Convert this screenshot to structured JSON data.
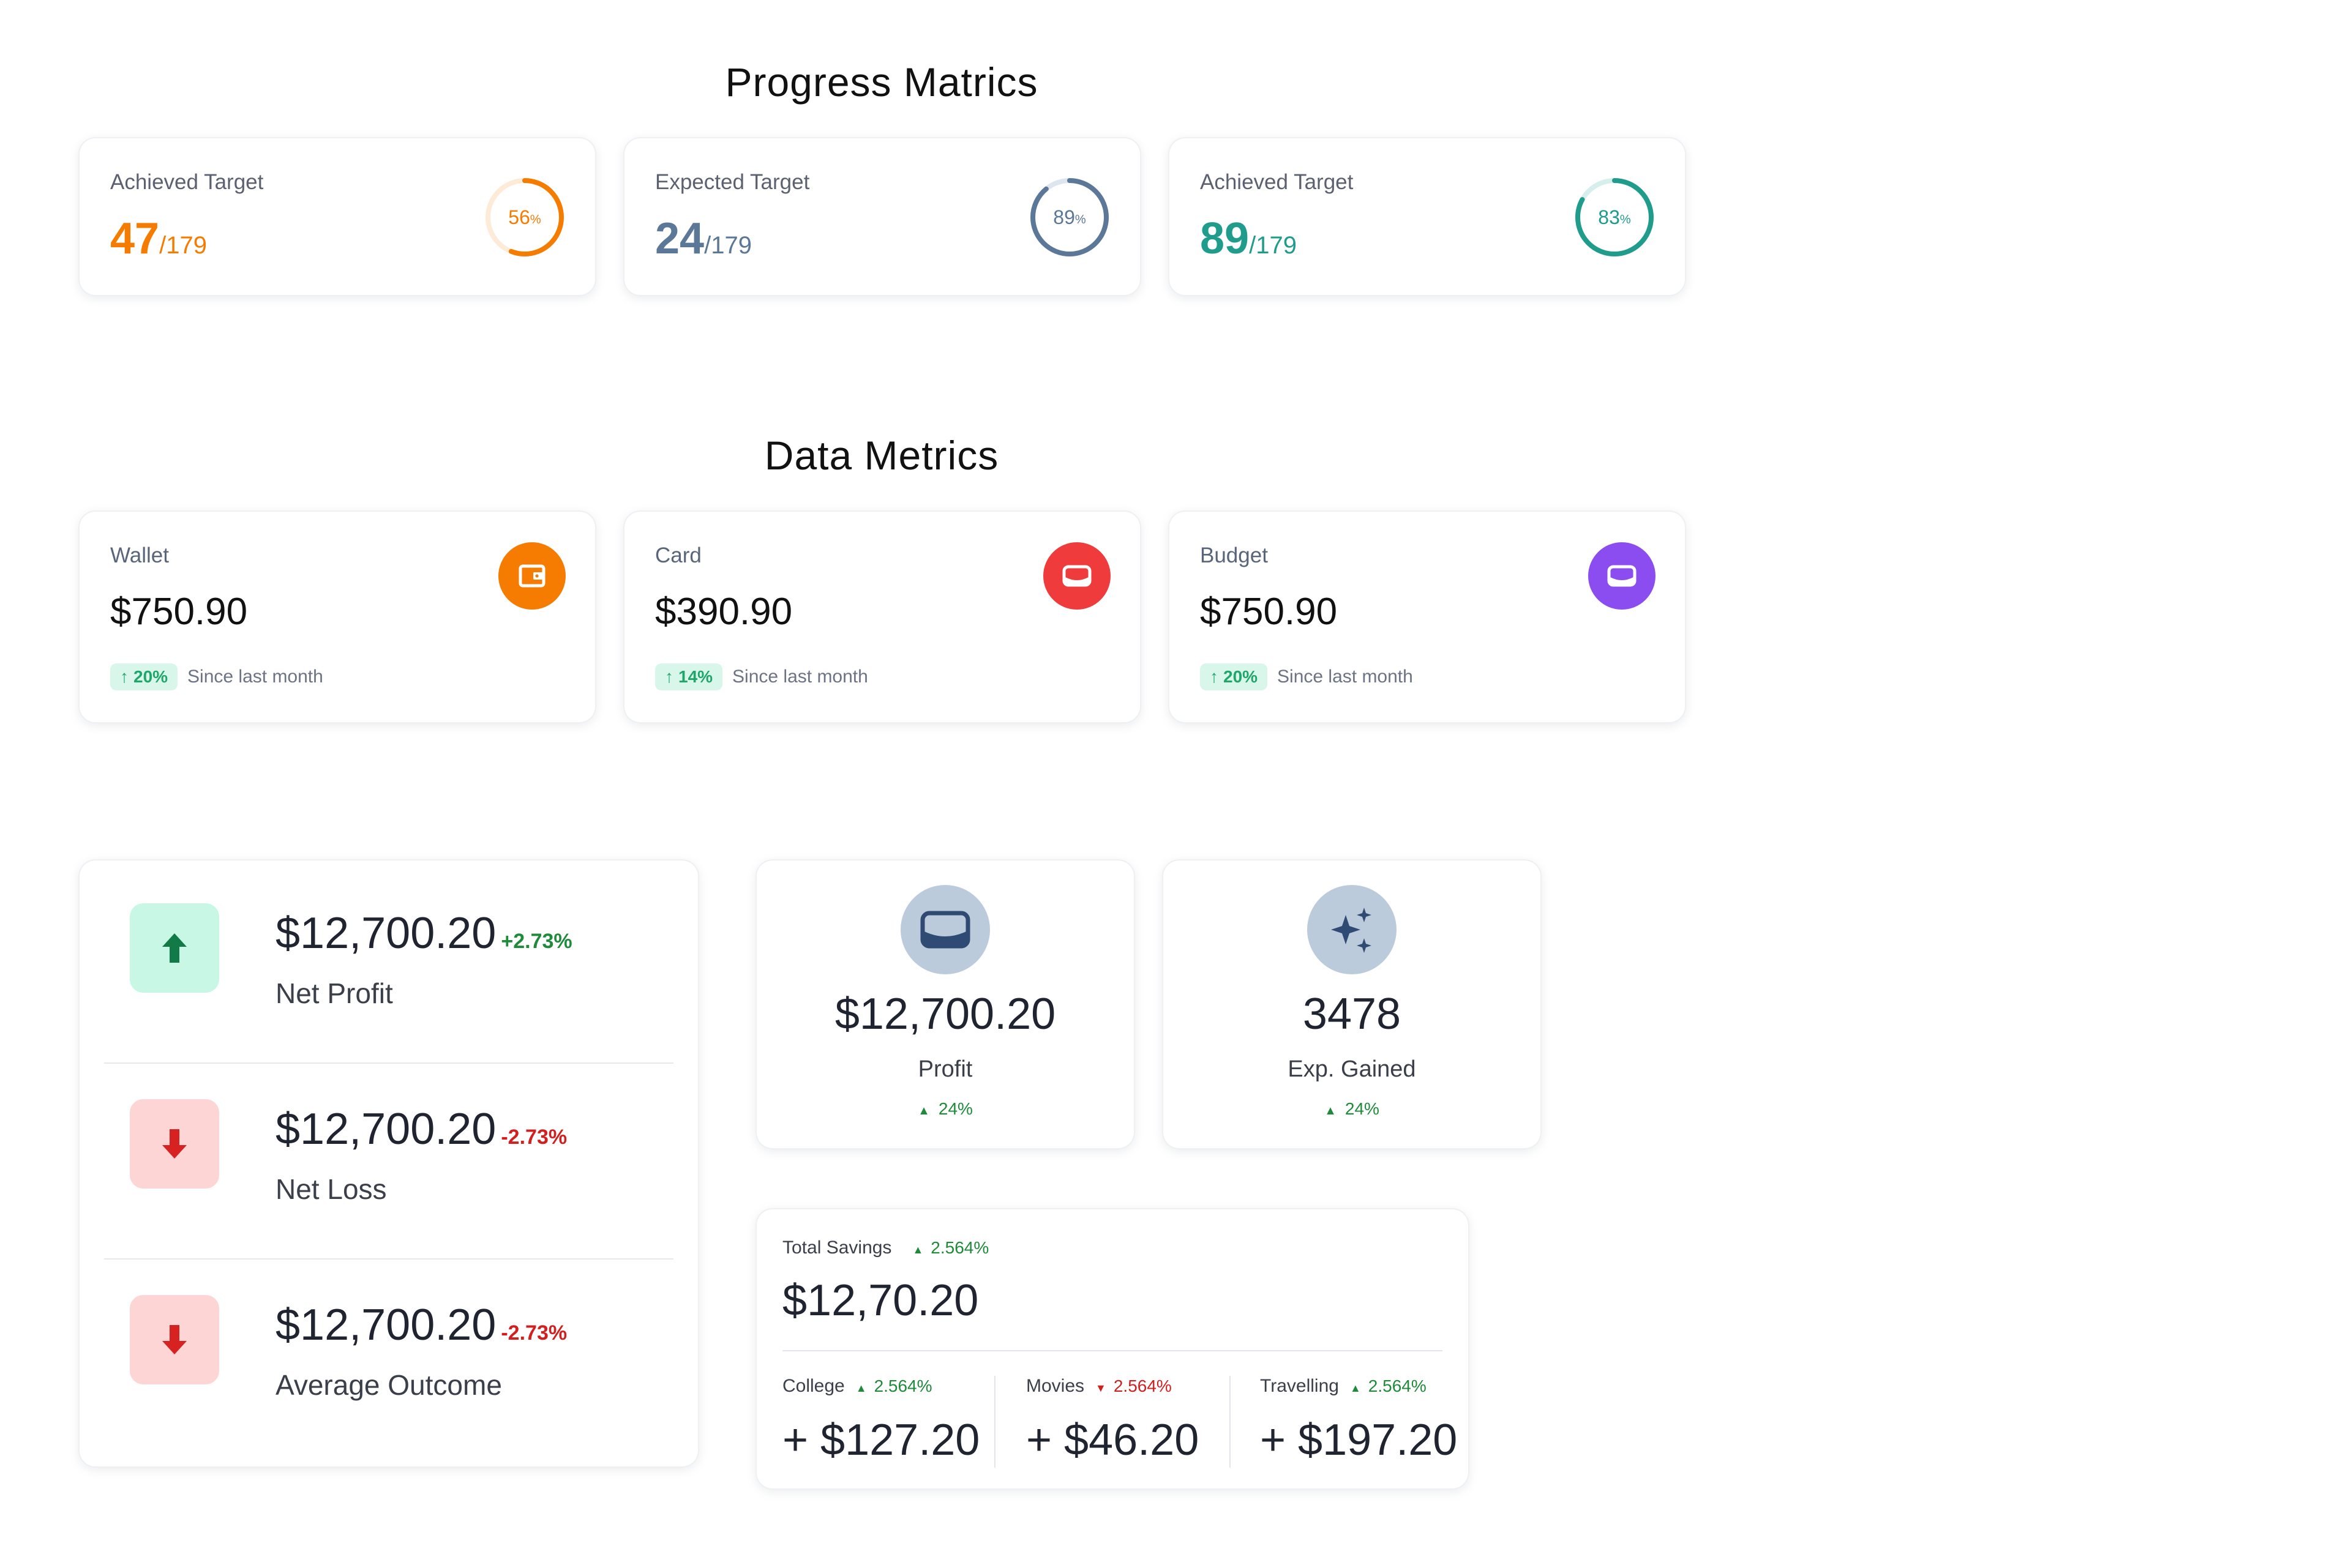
{
  "progress_section": {
    "title": "Progress Matrics",
    "cards": [
      {
        "label": "Achieved Target",
        "value": "47",
        "denominator": "/179",
        "percent": 56,
        "percent_label": "56",
        "percent_symbol": "%",
        "color": "#f57c00",
        "track_color": "#fdebd8"
      },
      {
        "label": "Expected Target",
        "value": "24",
        "denominator": "/179",
        "percent": 89,
        "percent_label": "89",
        "percent_symbol": "%",
        "color": "#5b7898",
        "track_color": "#dde5ee"
      },
      {
        "label": "Achieved Target",
        "value": "89",
        "denominator": "/179",
        "percent": 83,
        "percent_label": "83",
        "percent_symbol": "%",
        "color": "#1f9c8c",
        "track_color": "#d6efec"
      }
    ]
  },
  "data_section": {
    "title": "Data Metrics",
    "cards": [
      {
        "label": "Wallet",
        "value": "$750.90",
        "change": "20%",
        "since": "Since last month",
        "icon": "wallet-icon",
        "icon_color": "#f57c00"
      },
      {
        "label": "Card",
        "value": "$390.90",
        "change": "14%",
        "since": "Since last month",
        "icon": "card-icon",
        "icon_color": "#ef3b3b"
      },
      {
        "label": "Budget",
        "value": "$750.90",
        "change": "20%",
        "since": "Since last month",
        "icon": "card-icon",
        "icon_color": "#8b4cf0"
      }
    ]
  },
  "summary_list": {
    "items": [
      {
        "amount": "$12,700.20",
        "change": "+2.73%",
        "label": "Net Profit",
        "direction": "up",
        "icon": "arrow-up-icon"
      },
      {
        "amount": "$12,700.20",
        "change": "-2.73%",
        "label": "Net Loss",
        "direction": "down",
        "icon": "arrow-down-icon"
      },
      {
        "amount": "$12,700.20",
        "change": "-2.73%",
        "label": "Average Outcome",
        "direction": "down",
        "icon": "arrow-down-icon"
      }
    ]
  },
  "stat_cards": [
    {
      "value": "$12,700.20",
      "label": "Profit",
      "change": "24%",
      "icon": "card-icon"
    },
    {
      "value": "3478",
      "label": "Exp. Gained",
      "change": "24%",
      "icon": "sparkles-icon"
    }
  ],
  "savings": {
    "label": "Total Savings",
    "change": "2.564%",
    "value": "$12,70.20",
    "columns": [
      {
        "label": "College",
        "change": "2.564%",
        "direction": "up",
        "value": "+ $127.20"
      },
      {
        "label": "Movies",
        "change": "2.564%",
        "direction": "down",
        "value": "+ $46.20"
      },
      {
        "label": "Travelling",
        "change": "2.564%",
        "direction": "up",
        "value": "+ $197.20"
      }
    ]
  },
  "colors": {
    "up_green": "#1f8a3a",
    "down_red": "#d21f1f",
    "up_bg": "#c8f7e6",
    "down_bg": "#fdd5d5",
    "up_icon": "#127a47",
    "down_icon": "#d72222",
    "stat_icon_bg": "#bccbdb",
    "stat_icon_fg": "#2f4a73"
  }
}
